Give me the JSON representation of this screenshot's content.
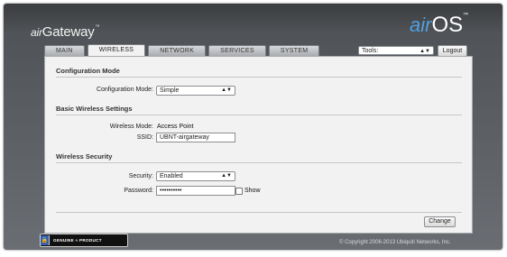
{
  "header": {
    "brand_prefix": "air",
    "brand_name": "Gateway",
    "brand_tm": "™",
    "os_prefix": "air",
    "os_name": "OS",
    "os_tm": "™"
  },
  "tabs": [
    {
      "label": "MAIN",
      "active": false
    },
    {
      "label": "WIRELESS",
      "active": true
    },
    {
      "label": "NETWORK",
      "active": false
    },
    {
      "label": "SERVICES",
      "active": false
    },
    {
      "label": "SYSTEM",
      "active": false
    }
  ],
  "tools": {
    "selected": "Tools:",
    "caret": "▲▼"
  },
  "logout_label": "Logout",
  "config_mode": {
    "title": "Configuration Mode",
    "label": "Configuration Mode:",
    "value": "Simple"
  },
  "basic_wireless": {
    "title": "Basic Wireless Settings",
    "mode_label": "Wireless Mode:",
    "mode_value": "Access Point",
    "ssid_label": "SSID:",
    "ssid_value": "UBNT-airgateway"
  },
  "security": {
    "title": "Wireless Security",
    "security_label": "Security:",
    "security_value": "Enabled",
    "password_label": "Password:",
    "password_value": "••••••••••",
    "show_label": "Show"
  },
  "change_label": "Change",
  "footer": {
    "badge_text": "GENUINE  ≈  PRODUCT",
    "copyright": "© Copyright 2006-2013 Ubiquiti Networks, Inc."
  },
  "colors": {
    "frame_dark": "#3b3d40",
    "panel_bg": "#f2f2f2",
    "os_accent": "#4f9ee0",
    "badge_blue": "#3a5fa8"
  }
}
